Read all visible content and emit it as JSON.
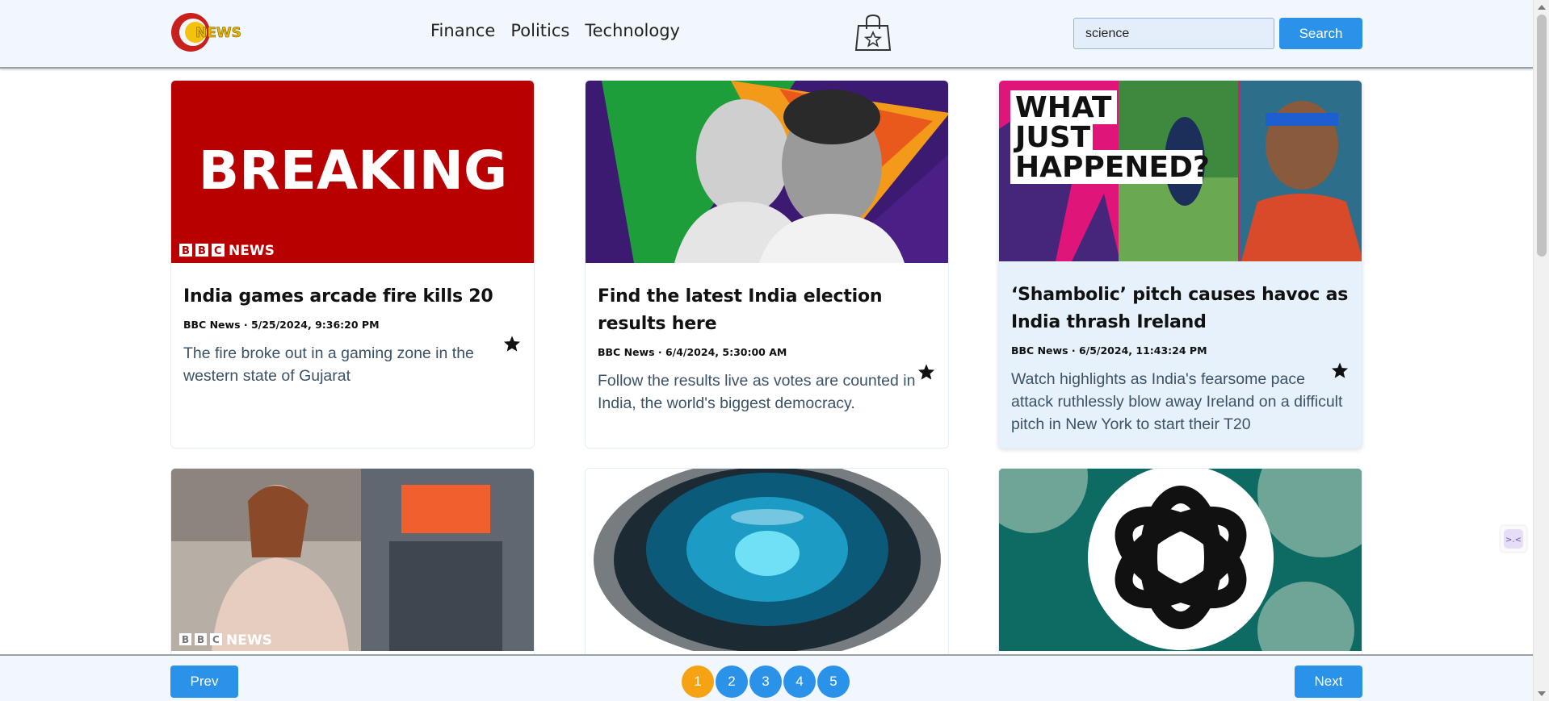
{
  "header": {
    "logo_text": "NEWS",
    "nav": [
      "Finance",
      "Politics",
      "Technology"
    ],
    "search": {
      "value": "science",
      "button_label": "Search"
    }
  },
  "cards": [
    {
      "title": "India games arcade fire kills 20",
      "meta": "BBC News · 5/25/2024, 9:36:20 PM",
      "description": "The fire broke out in a gaming zone in the western state of Gujarat",
      "image": {
        "overlay_text": "BREAKING",
        "brand": "NEWS"
      }
    },
    {
      "title": "Find the latest India election results here",
      "meta": "BBC News · 6/4/2024, 5:30:00 AM",
      "description": "Follow the results live as votes are counted in India, the world's biggest democracy."
    },
    {
      "title": "‘Shambolic’ pitch causes havoc as India thrash Ireland",
      "meta": "BBC News · 6/5/2024, 11:43:24 PM",
      "description": "Watch highlights as India's fearsome pace attack ruthlessly blow away Ireland on a difficult pitch in New York to start their T20",
      "image": {
        "overlay_text": [
          "WHAT",
          "JUST",
          "HAPPENED?"
        ]
      }
    },
    {
      "image": {
        "brand": "NEWS"
      }
    },
    {},
    {}
  ],
  "footer": {
    "prev_label": "Prev",
    "next_label": "Next",
    "pages": [
      "1",
      "2",
      "3",
      "4",
      "5"
    ],
    "active_page": "1"
  },
  "colors": {
    "primary": "#2b92ea",
    "active_page": "#f6a313",
    "header_bg": "#f1f7fd",
    "breaking_red": "#b80000"
  }
}
